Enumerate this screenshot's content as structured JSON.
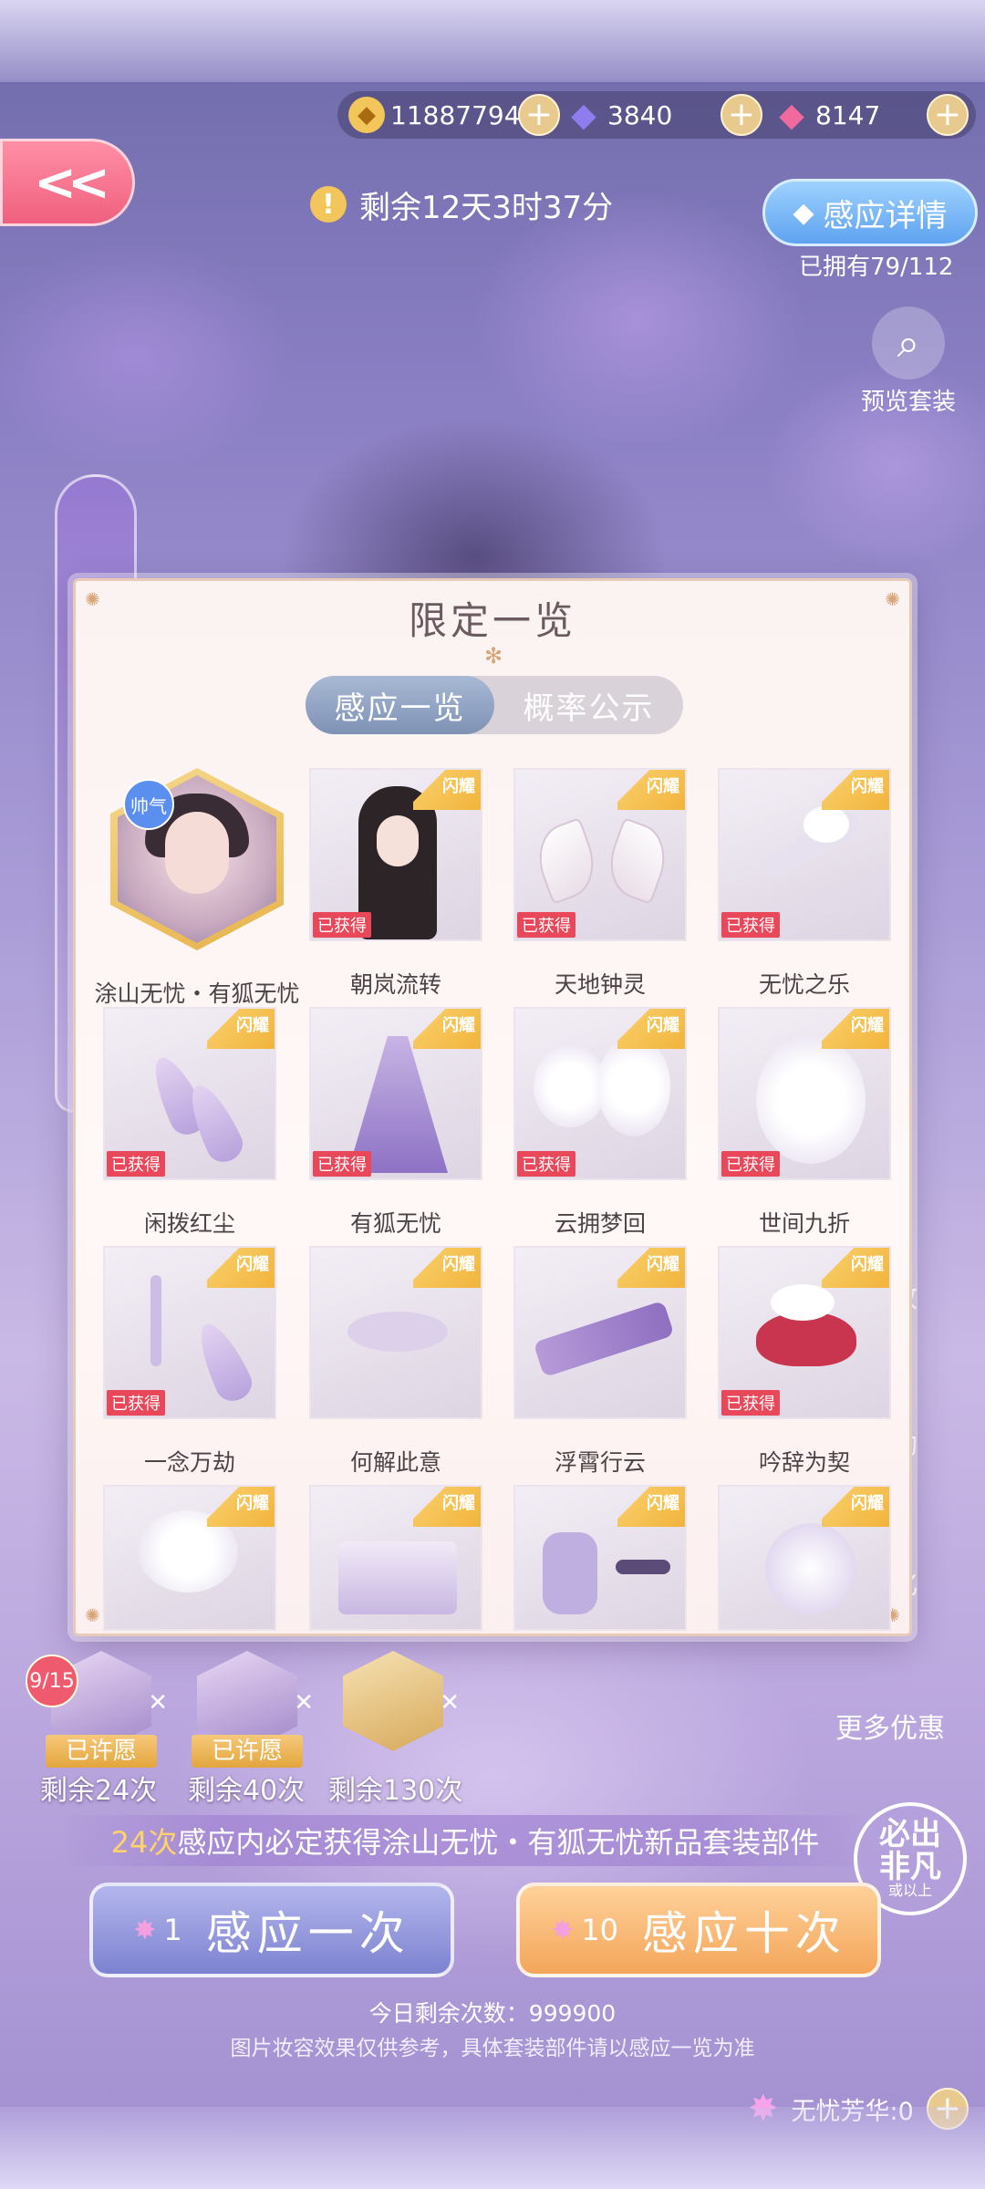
{
  "currency": {
    "gold": "11887794",
    "diamond": "3840",
    "pink_diamond": "8147",
    "plus": "+"
  },
  "back": {
    "label": "<<"
  },
  "timer": {
    "icon": "!",
    "text": "剩余12天3时37分"
  },
  "detail_button": {
    "label": "感应详情"
  },
  "owned": "已拥有79/112",
  "preview": {
    "label": "预览套装"
  },
  "side_tabs": {
    "bloom": "绽放",
    "reward": "奖励",
    "convert": "转化",
    "more": "更多优惠"
  },
  "modal": {
    "title": "限定一览",
    "tabs": [
      {
        "label": "感应一览",
        "active": true
      },
      {
        "label": "概率公示",
        "active": false
      }
    ],
    "ribbon": "闪耀",
    "acquired": "已获得",
    "hq_badge": "帅气",
    "items": [
      {
        "name": "涂山无忧・有狐无忧",
        "acquired": false,
        "kind": "portrait"
      },
      {
        "name": "朝岚流转",
        "acquired": true
      },
      {
        "name": "天地钟灵",
        "acquired": true
      },
      {
        "name": "无忧之乐",
        "acquired": true
      },
      {
        "name": "闲拨红尘",
        "acquired": true
      },
      {
        "name": "有狐无忧",
        "acquired": true
      },
      {
        "name": "云拥梦回",
        "acquired": true
      },
      {
        "name": "世间九折",
        "acquired": true
      },
      {
        "name": "一念万劫",
        "acquired": true
      },
      {
        "name": "何解此意",
        "acquired": false
      },
      {
        "name": "浮霄行云",
        "acquired": false
      },
      {
        "name": "吟辞为契",
        "acquired": true
      },
      {
        "name": "",
        "acquired": false
      },
      {
        "name": "",
        "acquired": false
      },
      {
        "name": "",
        "acquired": false
      },
      {
        "name": "",
        "acquired": false
      }
    ]
  },
  "wishes": [
    {
      "tag": "已许愿",
      "remaining": "剩余24次",
      "progress": "9/15"
    },
    {
      "tag": "已许愿",
      "remaining": "剩余40次"
    },
    {
      "tag": "",
      "remaining": "剩余130次"
    }
  ],
  "guarantee": {
    "count": "24次",
    "text": "感应内必定获得涂山无忧・有狐无忧新品套装部件"
  },
  "seal": {
    "line1": "必出",
    "line2": "非凡",
    "line3": "或以上"
  },
  "pull_once": {
    "count": "1",
    "label": "感应一次"
  },
  "pull_ten": {
    "count": "10",
    "label": "感应十次"
  },
  "remaining_today": "今日剩余次数：999900",
  "notice": "图片妆容效果仅供参考，具体套装部件请以感应一览为准",
  "tokens": {
    "label": "无忧芳华:0"
  }
}
